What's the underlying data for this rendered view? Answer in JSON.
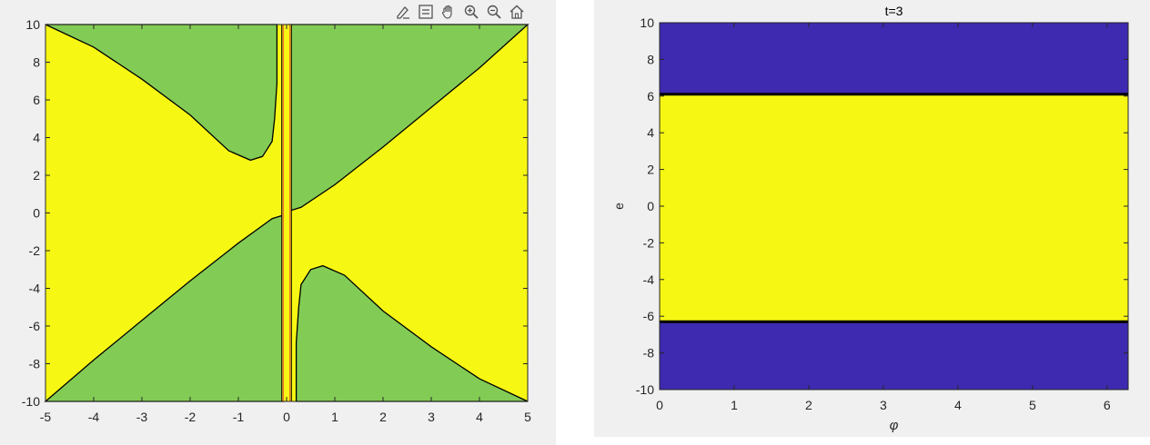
{
  "toolbar": {
    "icons": [
      "edit-plot-icon",
      "legend-icon",
      "pan-hand-icon",
      "zoom-in-icon",
      "zoom-out-icon",
      "home-icon"
    ]
  },
  "chart_data": [
    {
      "type": "heatmap",
      "title": "",
      "xlabel": "",
      "ylabel": "",
      "xlim": [
        -5,
        5
      ],
      "ylim": [
        -10,
        10
      ],
      "xticks": [
        "-5",
        "-4",
        "-3",
        "-2",
        "-1",
        "0",
        "1",
        "2",
        "3",
        "4",
        "5"
      ],
      "yticks": [
        "10",
        "8",
        "6",
        "4",
        "2",
        "0",
        "-2",
        "-4",
        "-6",
        "-8",
        "-10"
      ],
      "colors": {
        "green": "#82cc55",
        "yellow": "#f7f714",
        "orange": "#e8782a",
        "boundary": "#000000",
        "background": "#f0f0f0"
      },
      "regions": {
        "upper_left_green_boundary": [
          [
            -5,
            10
          ],
          [
            -4,
            8.8
          ],
          [
            -3,
            7.1
          ],
          [
            -2,
            5.2
          ],
          [
            -1.2,
            3.3
          ],
          [
            -0.75,
            2.8
          ],
          [
            -0.5,
            3.0
          ],
          [
            -0.3,
            3.8
          ],
          [
            -0.25,
            5.0
          ],
          [
            -0.2,
            6.9
          ]
        ],
        "upper_right_green_boundary": [
          [
            0.05,
            0.1
          ],
          [
            0.3,
            0.3
          ],
          [
            1,
            1.5
          ],
          [
            2,
            3.5
          ],
          [
            3,
            5.6
          ],
          [
            4,
            7.7
          ],
          [
            5,
            10
          ]
        ],
        "lower_left_green_boundary": [
          [
            -5,
            -10
          ],
          [
            -4,
            -7.8
          ],
          [
            -3,
            -5.7
          ],
          [
            -2,
            -3.6
          ],
          [
            -1,
            -1.6
          ],
          [
            -0.3,
            -0.3
          ],
          [
            -0.05,
            -0.1
          ]
        ],
        "lower_right_green_boundary": [
          [
            0.2,
            -6.9
          ],
          [
            0.25,
            -5.0
          ],
          [
            0.3,
            -3.8
          ],
          [
            0.5,
            -3.0
          ],
          [
            0.75,
            -2.8
          ],
          [
            1.2,
            -3.3
          ],
          [
            2,
            -5.2
          ],
          [
            3,
            -7.1
          ],
          [
            4,
            -8.8
          ],
          [
            5,
            -10
          ]
        ],
        "central_strip_x": [
          -0.1,
          0.1
        ]
      }
    },
    {
      "type": "heatmap",
      "title": "t=3",
      "xlabel": "φ",
      "ylabel": "e",
      "xlim": [
        0,
        6.283
      ],
      "ylim": [
        -10,
        10
      ],
      "xticks": [
        "0",
        "1",
        "2",
        "3",
        "4",
        "5",
        "6"
      ],
      "yticks": [
        "10",
        "8",
        "6",
        "4",
        "2",
        "0",
        "-2",
        "-4",
        "-6",
        "-8",
        "-10"
      ],
      "colors": {
        "blue": "#3d2ab0",
        "yellow": "#f7f714",
        "boundary": "#000000"
      },
      "bands": [
        {
          "from": 6.1,
          "to": 10,
          "color": "blue"
        },
        {
          "from": -6.3,
          "to": 6.1,
          "color": "yellow"
        },
        {
          "from": -10,
          "to": -6.3,
          "color": "blue"
        }
      ],
      "boundary_lines": [
        6.1,
        -6.3
      ]
    }
  ]
}
